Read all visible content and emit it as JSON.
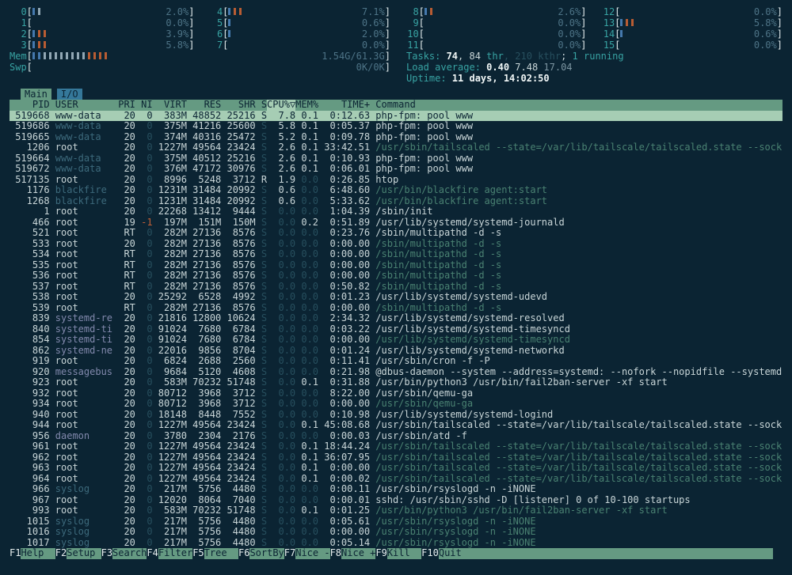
{
  "colors": {
    "background": "#0b2433",
    "foreground": "#c9d6d8",
    "accent_teal": "#38a3a3",
    "header_green": "#659a82",
    "selection_green": "#a6cdb4",
    "io_tab_blue": "#35789a",
    "bar_blue": "#4579ad",
    "bar_orange": "#b85c33",
    "bar_gray": "#91a7b4",
    "dim": "#274f5e",
    "command_dim_teal": "#4a8272"
  },
  "header": {
    "cpu_meters": [
      {
        "id": "0",
        "value": "2.0%",
        "bars": [
          "b",
          "g"
        ]
      },
      {
        "id": "4",
        "value": "7.1%",
        "bars": [
          "b",
          "o",
          "o"
        ]
      },
      {
        "id": "8",
        "value": "2.6%",
        "bars": [
          "b",
          "o"
        ]
      },
      {
        "id": "12",
        "value": "0.0%",
        "bars": []
      },
      {
        "id": "1",
        "value": "0.0%",
        "bars": []
      },
      {
        "id": "5",
        "value": "0.6%",
        "bars": [
          "b"
        ]
      },
      {
        "id": "9",
        "value": "0.0%",
        "bars": []
      },
      {
        "id": "13",
        "value": "5.8%",
        "bars": [
          "b",
          "o",
          "o"
        ]
      },
      {
        "id": "2",
        "value": "3.9%",
        "bars": [
          "b",
          "o",
          "o"
        ]
      },
      {
        "id": "6",
        "value": "2.0%",
        "bars": [
          "b"
        ]
      },
      {
        "id": "10",
        "value": "0.0%",
        "bars": []
      },
      {
        "id": "14",
        "value": "0.6%",
        "bars": [
          "b"
        ]
      },
      {
        "id": "3",
        "value": "5.8%",
        "bars": [
          "b",
          "o",
          "o"
        ]
      },
      {
        "id": "7",
        "value": "0.0%",
        "bars": []
      },
      {
        "id": "11",
        "value": "0.0%",
        "bars": []
      },
      {
        "id": "15",
        "value": "0.0%",
        "bars": []
      }
    ],
    "mem_meter": {
      "label": "Mem",
      "value": "1.54G/61.3G",
      "bars": [
        "b",
        "b",
        "g",
        "g",
        "g",
        "g",
        "g",
        "g",
        "g",
        "g",
        "o",
        "o",
        "o",
        "o"
      ]
    },
    "swp_meter": {
      "label": "Swp",
      "value": "0K/0K",
      "bars": []
    },
    "tasks_line": [
      {
        "t": "Tasks: ",
        "c": "label"
      },
      {
        "t": "74",
        "c": "bold"
      },
      {
        "t": ", ",
        "c": ""
      },
      {
        "t": "84",
        "c": ""
      },
      {
        "t": " thr",
        "c": "label"
      },
      {
        "t": ", 210 kthr",
        "c": "dim"
      },
      {
        "t": "; ",
        "c": ""
      },
      {
        "t": "1 running",
        "c": "label"
      }
    ],
    "load_line": [
      {
        "t": "Load average: ",
        "c": "label"
      },
      {
        "t": "0.40",
        "c": "bold"
      },
      {
        "t": " 7.48",
        "c": ""
      },
      {
        "t": " 17.04",
        "c": "fade"
      }
    ],
    "uptime_line": [
      {
        "t": "Uptime: ",
        "c": "label"
      },
      {
        "t": "11 days, 14:02:50",
        "c": "bold"
      }
    ]
  },
  "tabs": [
    {
      "label": "Main",
      "active": true
    },
    {
      "label": "I/O",
      "active": false
    }
  ],
  "table": {
    "columns": [
      "PID",
      "USER",
      "PRI",
      "NI",
      "VIRT",
      "RES",
      "SHR",
      "S",
      "CPU%▽",
      "MEM%",
      "TIME+",
      "Command"
    ],
    "sort_column": "CPU%▽",
    "rows": [
      {
        "pid": "519668",
        "user": "www-data",
        "uc": "dim",
        "pri": "20",
        "ni": "0",
        "virt": "383M",
        "res": "48852",
        "shr": "25216",
        "s": "S",
        "cpu": "7.8",
        "mem": "0.1",
        "time": "0:12.63",
        "cmd": "php-fpm: pool www",
        "cc": "",
        "sel": true
      },
      {
        "pid": "519686",
        "user": "www-data",
        "uc": "dim",
        "pri": "20",
        "ni": "0",
        "virt": "375M",
        "res": "41216",
        "shr": "25600",
        "s": "S",
        "cpu": "5.8",
        "mem": "0.1",
        "time": "0:05.37",
        "cmd": "php-fpm: pool www",
        "cc": ""
      },
      {
        "pid": "519665",
        "user": "www-data",
        "uc": "dim",
        "pri": "20",
        "ni": "0",
        "virt": "374M",
        "res": "40316",
        "shr": "25472",
        "s": "S",
        "cpu": "5.2",
        "mem": "0.1",
        "time": "0:09.78",
        "cmd": "php-fpm: pool www",
        "cc": ""
      },
      {
        "pid": "1206",
        "user": "root",
        "uc": "",
        "pri": "20",
        "ni": "0",
        "virt": "1227M",
        "res": "49564",
        "shr": "23424",
        "s": "S",
        "cpu": "2.6",
        "mem": "0.1",
        "time": "33:42.51",
        "cmd": "/usr/sbin/tailscaled --state=/var/lib/tailscale/tailscaled.state --socket=/run/tailscal",
        "cc": "dim"
      },
      {
        "pid": "519664",
        "user": "www-data",
        "uc": "dim",
        "pri": "20",
        "ni": "0",
        "virt": "375M",
        "res": "40512",
        "shr": "25216",
        "s": "S",
        "cpu": "2.6",
        "mem": "0.1",
        "time": "0:10.93",
        "cmd": "php-fpm: pool www",
        "cc": ""
      },
      {
        "pid": "519672",
        "user": "www-data",
        "uc": "dim",
        "pri": "20",
        "ni": "0",
        "virt": "376M",
        "res": "47172",
        "shr": "30976",
        "s": "S",
        "cpu": "2.6",
        "mem": "0.1",
        "time": "0:06.01",
        "cmd": "php-fpm: pool www",
        "cc": ""
      },
      {
        "pid": "517135",
        "user": "root",
        "uc": "",
        "pri": "20",
        "ni": "0",
        "virt": "8996",
        "res": "5248",
        "shr": "3712",
        "s": "R",
        "cpu": "1.9",
        "mem": "0.0",
        "time": "0:26.85",
        "cmd": "htop",
        "cc": ""
      },
      {
        "pid": "1176",
        "user": "blackfire",
        "uc": "dim",
        "pri": "20",
        "ni": "0",
        "virt": "1231M",
        "res": "31484",
        "shr": "20992",
        "s": "S",
        "cpu": "0.6",
        "mem": "0.0",
        "time": "6:48.60",
        "cmd": "/usr/bin/blackfire agent:start",
        "cc": "dim"
      },
      {
        "pid": "1268",
        "user": "blackfire",
        "uc": "dim",
        "pri": "20",
        "ni": "0",
        "virt": "1231M",
        "res": "31484",
        "shr": "20992",
        "s": "S",
        "cpu": "0.6",
        "mem": "0.0",
        "time": "5:33.62",
        "cmd": "/usr/bin/blackfire agent:start",
        "cc": "dim"
      },
      {
        "pid": "1",
        "user": "root",
        "uc": "",
        "pri": "20",
        "ni": "0",
        "virt": "22268",
        "res": "13412",
        "shr": "9444",
        "s": "S",
        "cpu": "0.0",
        "mem": "0.0",
        "time": "1:04.39",
        "cmd": "/sbin/init",
        "cc": ""
      },
      {
        "pid": "466",
        "user": "root",
        "uc": "",
        "pri": "19",
        "ni": "-1",
        "nc": "neg",
        "virt": "197M",
        "res": "151M",
        "shr": "150M",
        "s": "S",
        "cpu": "0.0",
        "mem": "0.2",
        "time": "0:51.89",
        "cmd": "/usr/lib/systemd/systemd-journald",
        "cc": ""
      },
      {
        "pid": "521",
        "user": "root",
        "uc": "",
        "pri": "RT",
        "ni": "0",
        "virt": "282M",
        "res": "27136",
        "shr": "8576",
        "s": "S",
        "cpu": "0.0",
        "mem": "0.0",
        "time": "0:23.76",
        "cmd": "/sbin/multipathd -d -s",
        "cc": ""
      },
      {
        "pid": "533",
        "user": "root",
        "uc": "",
        "pri": "20",
        "ni": "0",
        "virt": "282M",
        "res": "27136",
        "shr": "8576",
        "s": "S",
        "cpu": "0.0",
        "mem": "0.0",
        "time": "0:00.00",
        "cmd": "/sbin/multipathd -d -s",
        "cc": "dim"
      },
      {
        "pid": "534",
        "user": "root",
        "uc": "",
        "pri": "RT",
        "ni": "0",
        "virt": "282M",
        "res": "27136",
        "shr": "8576",
        "s": "S",
        "cpu": "0.0",
        "mem": "0.0",
        "time": "0:00.00",
        "cmd": "/sbin/multipathd -d -s",
        "cc": "dim"
      },
      {
        "pid": "535",
        "user": "root",
        "uc": "",
        "pri": "RT",
        "ni": "0",
        "virt": "282M",
        "res": "27136",
        "shr": "8576",
        "s": "S",
        "cpu": "0.0",
        "mem": "0.0",
        "time": "0:00.00",
        "cmd": "/sbin/multipathd -d -s",
        "cc": "dim"
      },
      {
        "pid": "536",
        "user": "root",
        "uc": "",
        "pri": "RT",
        "ni": "0",
        "virt": "282M",
        "res": "27136",
        "shr": "8576",
        "s": "S",
        "cpu": "0.0",
        "mem": "0.0",
        "time": "0:00.00",
        "cmd": "/sbin/multipathd -d -s",
        "cc": "dim"
      },
      {
        "pid": "537",
        "user": "root",
        "uc": "",
        "pri": "RT",
        "ni": "0",
        "virt": "282M",
        "res": "27136",
        "shr": "8576",
        "s": "S",
        "cpu": "0.0",
        "mem": "0.0",
        "time": "0:50.82",
        "cmd": "/sbin/multipathd -d -s",
        "cc": "dim"
      },
      {
        "pid": "538",
        "user": "root",
        "uc": "",
        "pri": "20",
        "ni": "0",
        "virt": "25292",
        "res": "6528",
        "shr": "4992",
        "s": "S",
        "cpu": "0.0",
        "mem": "0.0",
        "time": "0:01.23",
        "cmd": "/usr/lib/systemd/systemd-udevd",
        "cc": ""
      },
      {
        "pid": "539",
        "user": "root",
        "uc": "",
        "pri": "RT",
        "ni": "0",
        "virt": "282M",
        "res": "27136",
        "shr": "8576",
        "s": "S",
        "cpu": "0.0",
        "mem": "0.0",
        "time": "0:00.00",
        "cmd": "/sbin/multipathd -d -s",
        "cc": "dim"
      },
      {
        "pid": "839",
        "user": "systemd-re",
        "uc": "oth",
        "pri": "20",
        "ni": "0",
        "virt": "21816",
        "res": "12800",
        "shr": "10624",
        "s": "S",
        "cpu": "0.0",
        "mem": "0.0",
        "time": "2:34.32",
        "cmd": "/usr/lib/systemd/systemd-resolved",
        "cc": ""
      },
      {
        "pid": "840",
        "user": "systemd-ti",
        "uc": "oth",
        "pri": "20",
        "ni": "0",
        "virt": "91024",
        "res": "7680",
        "shr": "6784",
        "s": "S",
        "cpu": "0.0",
        "mem": "0.0",
        "time": "0:03.22",
        "cmd": "/usr/lib/systemd/systemd-timesyncd",
        "cc": ""
      },
      {
        "pid": "854",
        "user": "systemd-ti",
        "uc": "oth",
        "pri": "20",
        "ni": "0",
        "virt": "91024",
        "res": "7680",
        "shr": "6784",
        "s": "S",
        "cpu": "0.0",
        "mem": "0.0",
        "time": "0:00.00",
        "cmd": "/usr/lib/systemd/systemd-timesyncd",
        "cc": "dim"
      },
      {
        "pid": "862",
        "user": "systemd-ne",
        "uc": "oth",
        "pri": "20",
        "ni": "0",
        "virt": "22016",
        "res": "9856",
        "shr": "8704",
        "s": "S",
        "cpu": "0.0",
        "mem": "0.0",
        "time": "0:01.24",
        "cmd": "/usr/lib/systemd/systemd-networkd",
        "cc": ""
      },
      {
        "pid": "919",
        "user": "root",
        "uc": "",
        "pri": "20",
        "ni": "0",
        "virt": "6824",
        "res": "2688",
        "shr": "2560",
        "s": "S",
        "cpu": "0.0",
        "mem": "0.0",
        "time": "0:11.41",
        "cmd": "/usr/sbin/cron -f -P",
        "cc": ""
      },
      {
        "pid": "920",
        "user": "messagebus",
        "uc": "oth",
        "pri": "20",
        "ni": "0",
        "virt": "9684",
        "res": "5120",
        "shr": "4608",
        "s": "S",
        "cpu": "0.0",
        "mem": "0.0",
        "time": "0:21.98",
        "cmd": "@dbus-daemon --system --address=systemd: --nofork --nopidfile --systemd-activation --sy",
        "cc": ""
      },
      {
        "pid": "923",
        "user": "root",
        "uc": "",
        "pri": "20",
        "ni": "0",
        "virt": "583M",
        "res": "70232",
        "shr": "51748",
        "s": "S",
        "cpu": "0.0",
        "mem": "0.1",
        "time": "0:31.88",
        "cmd": "/usr/bin/python3 /usr/bin/fail2ban-server -xf start",
        "cc": ""
      },
      {
        "pid": "932",
        "user": "root",
        "uc": "",
        "pri": "20",
        "ni": "0",
        "virt": "80712",
        "res": "3968",
        "shr": "3712",
        "s": "S",
        "cpu": "0.0",
        "mem": "0.0",
        "time": "8:22.00",
        "cmd": "/usr/sbin/qemu-ga",
        "cc": ""
      },
      {
        "pid": "934",
        "user": "root",
        "uc": "",
        "pri": "20",
        "ni": "0",
        "virt": "80712",
        "res": "3968",
        "shr": "3712",
        "s": "S",
        "cpu": "0.0",
        "mem": "0.0",
        "time": "0:00.00",
        "cmd": "/usr/sbin/qemu-ga",
        "cc": "dim"
      },
      {
        "pid": "940",
        "user": "root",
        "uc": "",
        "pri": "20",
        "ni": "0",
        "virt": "18148",
        "res": "8448",
        "shr": "7552",
        "s": "S",
        "cpu": "0.0",
        "mem": "0.0",
        "time": "0:10.98",
        "cmd": "/usr/lib/systemd/systemd-logind",
        "cc": ""
      },
      {
        "pid": "944",
        "user": "root",
        "uc": "",
        "pri": "20",
        "ni": "0",
        "virt": "1227M",
        "res": "49564",
        "shr": "23424",
        "s": "S",
        "cpu": "0.0",
        "mem": "0.1",
        "time": "45:08.68",
        "cmd": "/usr/sbin/tailscaled --state=/var/lib/tailscale/tailscaled.state --socket=/run/tailscal",
        "cc": ""
      },
      {
        "pid": "956",
        "user": "daemon",
        "uc": "oth",
        "pri": "20",
        "ni": "0",
        "virt": "3780",
        "res": "2304",
        "shr": "2176",
        "s": "S",
        "cpu": "0.0",
        "mem": "0.0",
        "time": "0:00.03",
        "cmd": "/usr/sbin/atd -f",
        "cc": ""
      },
      {
        "pid": "961",
        "user": "root",
        "uc": "",
        "pri": "20",
        "ni": "0",
        "virt": "1227M",
        "res": "49564",
        "shr": "23424",
        "s": "S",
        "cpu": "0.0",
        "mem": "0.1",
        "time": "18:44.24",
        "cmd": "/usr/sbin/tailscaled --state=/var/lib/tailscale/tailscaled.state --socket=/run/tailscal",
        "cc": "dim"
      },
      {
        "pid": "962",
        "user": "root",
        "uc": "",
        "pri": "20",
        "ni": "0",
        "virt": "1227M",
        "res": "49564",
        "shr": "23424",
        "s": "S",
        "cpu": "0.0",
        "mem": "0.1",
        "time": "36:07.95",
        "cmd": "/usr/sbin/tailscaled --state=/var/lib/tailscale/tailscaled.state --socket=/run/tailscal",
        "cc": "dim"
      },
      {
        "pid": "963",
        "user": "root",
        "uc": "",
        "pri": "20",
        "ni": "0",
        "virt": "1227M",
        "res": "49564",
        "shr": "23424",
        "s": "S",
        "cpu": "0.0",
        "mem": "0.1",
        "time": "0:00.00",
        "cmd": "/usr/sbin/tailscaled --state=/var/lib/tailscale/tailscaled.state --socket=/run/tailscal",
        "cc": "dim"
      },
      {
        "pid": "964",
        "user": "root",
        "uc": "",
        "pri": "20",
        "ni": "0",
        "virt": "1227M",
        "res": "49564",
        "shr": "23424",
        "s": "S",
        "cpu": "0.0",
        "mem": "0.1",
        "time": "0:00.02",
        "cmd": "/usr/sbin/tailscaled --state=/var/lib/tailscale/tailscaled.state --socket=/run/tailscal",
        "cc": "dim"
      },
      {
        "pid": "966",
        "user": "syslog",
        "uc": "dim",
        "pri": "20",
        "ni": "0",
        "virt": "217M",
        "res": "5756",
        "shr": "4480",
        "s": "S",
        "cpu": "0.0",
        "mem": "0.0",
        "time": "0:00.11",
        "cmd": "/usr/sbin/rsyslogd -n -iNONE",
        "cc": ""
      },
      {
        "pid": "967",
        "user": "root",
        "uc": "",
        "pri": "20",
        "ni": "0",
        "virt": "12020",
        "res": "8064",
        "shr": "7040",
        "s": "S",
        "cpu": "0.0",
        "mem": "0.0",
        "time": "0:00.01",
        "cmd": "sshd: /usr/sbin/sshd -D [listener] 0 of 10-100 startups",
        "cc": ""
      },
      {
        "pid": "993",
        "user": "root",
        "uc": "",
        "pri": "20",
        "ni": "0",
        "virt": "583M",
        "res": "70232",
        "shr": "51748",
        "s": "S",
        "cpu": "0.0",
        "mem": "0.1",
        "time": "0:01.25",
        "cmd": "/usr/bin/python3 /usr/bin/fail2ban-server -xf start",
        "cc": "dim"
      },
      {
        "pid": "1015",
        "user": "syslog",
        "uc": "dim",
        "pri": "20",
        "ni": "0",
        "virt": "217M",
        "res": "5756",
        "shr": "4480",
        "s": "S",
        "cpu": "0.0",
        "mem": "0.0",
        "time": "0:05.61",
        "cmd": "/usr/sbin/rsyslogd -n -iNONE",
        "cc": "dim"
      },
      {
        "pid": "1016",
        "user": "syslog",
        "uc": "dim",
        "pri": "20",
        "ni": "0",
        "virt": "217M",
        "res": "5756",
        "shr": "4480",
        "s": "S",
        "cpu": "0.0",
        "mem": "0.0",
        "time": "0:00.00",
        "cmd": "/usr/sbin/rsyslogd -n -iNONE",
        "cc": "dim"
      },
      {
        "pid": "1017",
        "user": "syslog",
        "uc": "dim",
        "pri": "20",
        "ni": "0",
        "virt": "217M",
        "res": "5756",
        "shr": "4480",
        "s": "S",
        "cpu": "0.0",
        "mem": "0.0",
        "time": "0:05.14",
        "cmd": "/usr/sbin/rsyslogd -n -iNONE",
        "cc": "dim"
      }
    ]
  },
  "fnbar": [
    {
      "key": "F1",
      "label": "Help"
    },
    {
      "key": "F2",
      "label": "Setup"
    },
    {
      "key": "F3",
      "label": "Search"
    },
    {
      "key": "F4",
      "label": "Filter"
    },
    {
      "key": "F5",
      "label": "Tree"
    },
    {
      "key": "F6",
      "label": "SortBy"
    },
    {
      "key": "F7",
      "label": "Nice -"
    },
    {
      "key": "F8",
      "label": "Nice +"
    },
    {
      "key": "F9",
      "label": "Kill"
    },
    {
      "key": "F10",
      "label": "Quit"
    }
  ]
}
